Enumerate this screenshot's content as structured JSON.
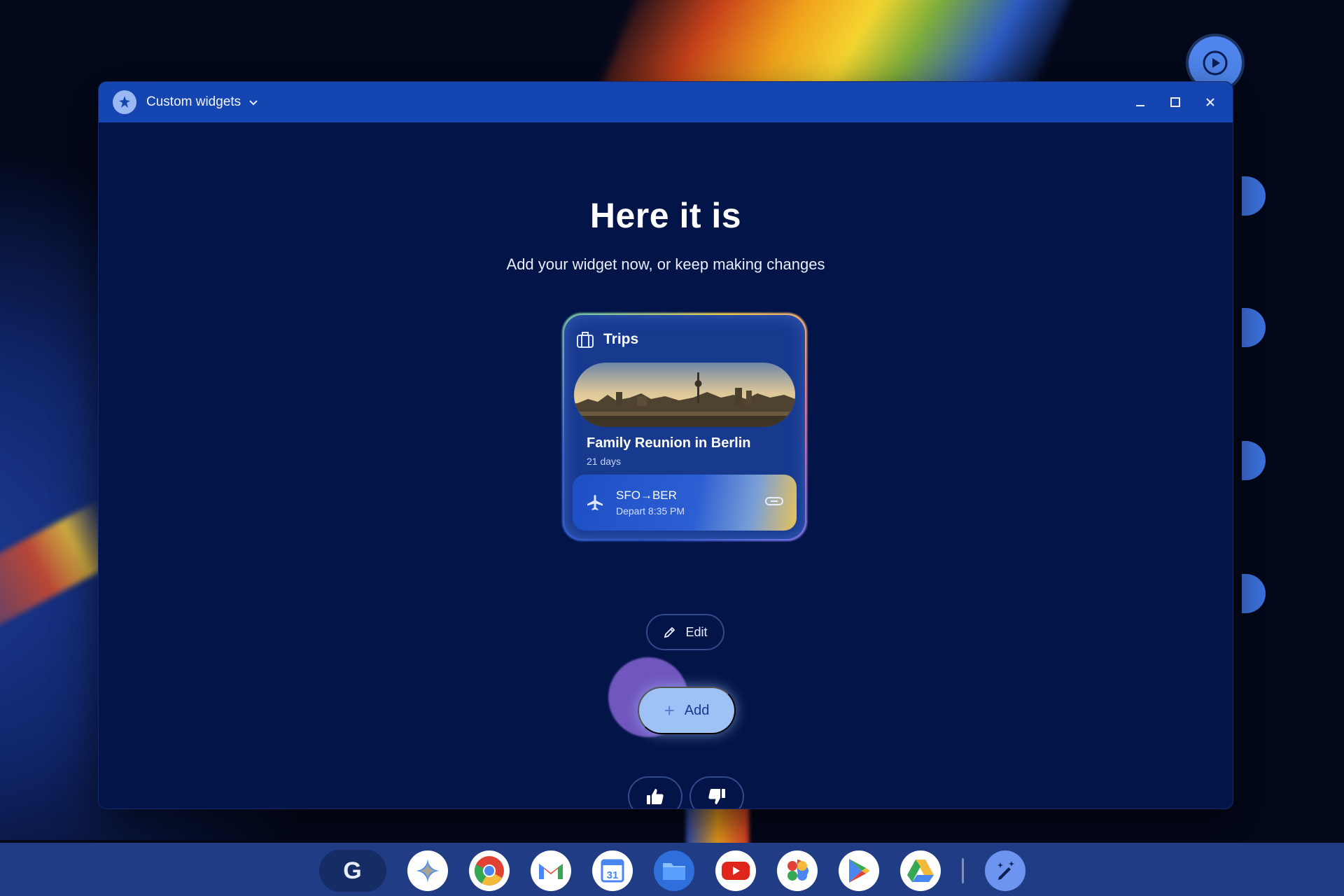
{
  "window": {
    "title": "Custom widgets"
  },
  "main": {
    "heading": "Here it is",
    "subheading": "Add your widget now, or keep making changes"
  },
  "widget": {
    "title": "Trips",
    "trip_name": "Family Reunion in Berlin",
    "duration": "21 days",
    "flight_route": "SFO→BER",
    "flight_depart": "Depart 8:35 PM"
  },
  "actions": {
    "edit_label": "Edit",
    "add_label": "Add"
  },
  "shelf": {
    "launcher_label": "G",
    "apps": [
      "gemini-icon",
      "chrome-icon",
      "gmail-icon",
      "calendar-icon",
      "files-icon",
      "youtube-icon",
      "photos-icon",
      "play-store-icon",
      "drive-icon"
    ],
    "calendar_day": "31"
  },
  "colors": {
    "window_bg": "#031548",
    "titlebar": "#1545b0",
    "accent": "#9ec1f6",
    "widget_bg": "#173a8f",
    "shelf": "#1f3c84"
  }
}
